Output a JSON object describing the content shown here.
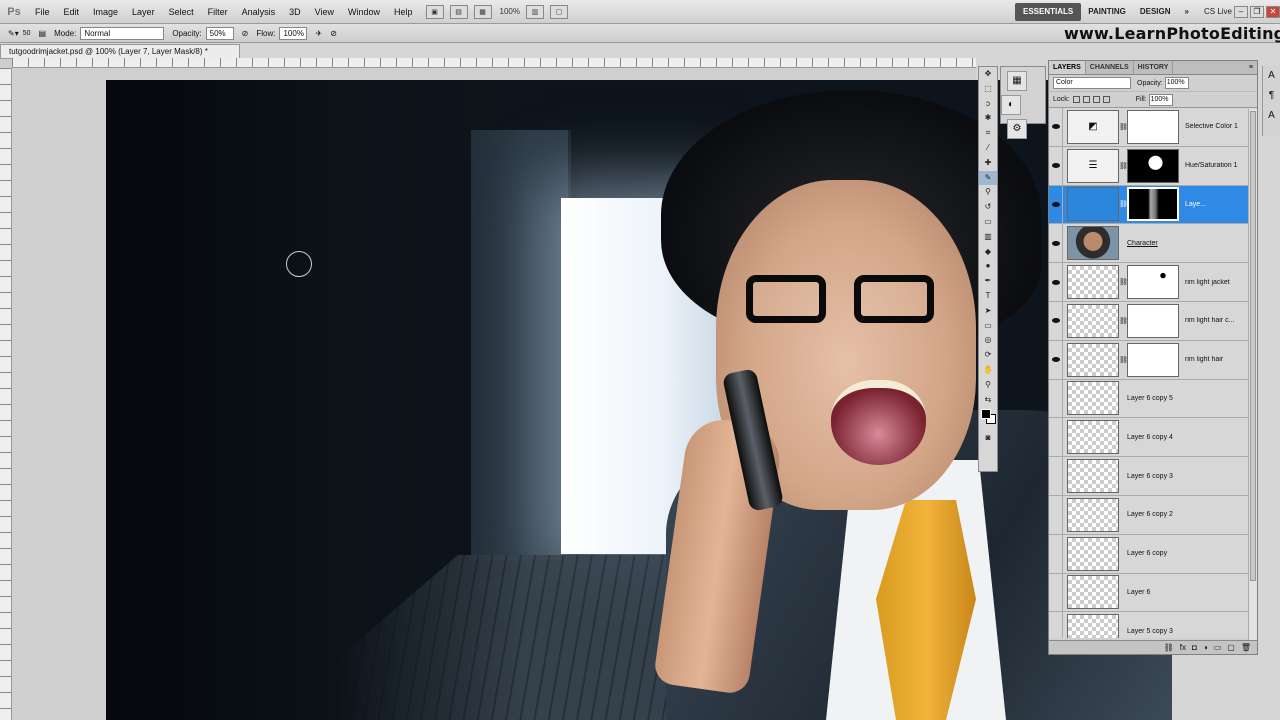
{
  "app": {
    "logo": "Ps"
  },
  "menu": [
    "File",
    "Edit",
    "Image",
    "Layer",
    "Select",
    "Filter",
    "Analysis",
    "3D",
    "View",
    "Window",
    "Help"
  ],
  "appbar": {
    "zoom": "100%",
    "workspaces": [
      "ESSENTIALS",
      "PAINTING",
      "DESIGN"
    ],
    "more": "»",
    "cs_live": "CS Live"
  },
  "options": {
    "brush_size": "50",
    "mode_label": "Mode:",
    "mode_value": "Normal",
    "opacity_label": "Opacity:",
    "opacity_value": "50%",
    "flow_label": "Flow:",
    "flow_value": "100%"
  },
  "watermark": "www.LearnPhotoEditing.net",
  "document": {
    "tab_title": "tutgoodrimjacket.psd @ 100% (Layer 7, Layer Mask/8) *"
  },
  "panel": {
    "tabs": [
      "LAYERS",
      "CHANNELS",
      "HISTORY"
    ],
    "blend_mode": "Color",
    "opacity_label": "Opacity:",
    "opacity_value": "100%",
    "lock_label": "Lock:",
    "fill_label": "Fill:",
    "fill_value": "100%"
  },
  "layers": [
    {
      "name": "Selective Color 1",
      "visible": true
    },
    {
      "name": "Hue/Saturation 1",
      "visible": true
    },
    {
      "name": "Laye...",
      "visible": true,
      "selected": true
    },
    {
      "name": "Character",
      "visible": true
    },
    {
      "name": "rim light jacket",
      "visible": true
    },
    {
      "name": "rim light hair c...",
      "visible": true
    },
    {
      "name": "rim light hair",
      "visible": true
    },
    {
      "name": "Layer 6 copy 5",
      "visible": false
    },
    {
      "name": "Layer 6 copy 4",
      "visible": false
    },
    {
      "name": "Layer 6 copy 3",
      "visible": false
    },
    {
      "name": "Layer 6 copy 2",
      "visible": false
    },
    {
      "name": "Layer 6 copy",
      "visible": false
    },
    {
      "name": "Layer 6",
      "visible": false
    },
    {
      "name": "Layer 5 copy 3",
      "visible": false
    }
  ],
  "colors": {
    "selected_layer": "#2f8ae6",
    "active_workspace": "#555555"
  }
}
